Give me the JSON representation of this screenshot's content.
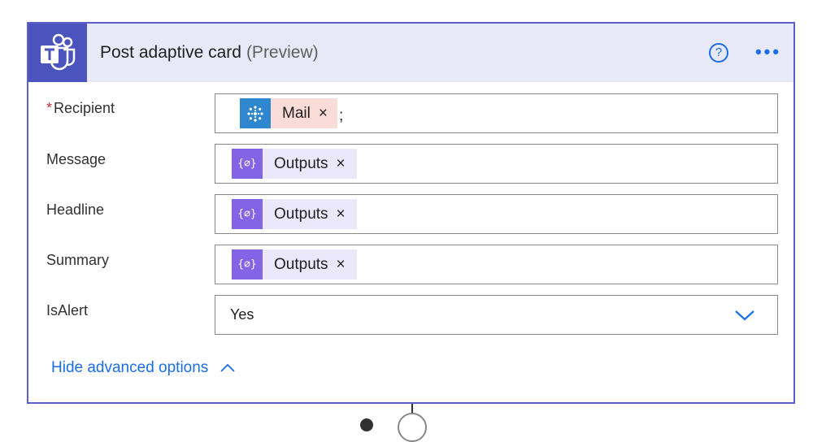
{
  "header": {
    "title": "Post adaptive card",
    "title_suffix": "(Preview)",
    "help_glyph": "?",
    "more_glyph": "•••",
    "icons": {
      "app": "teams-icon",
      "help": "help-circle-icon",
      "more": "more-icon"
    }
  },
  "fields": {
    "recipient": {
      "required_mark": "*",
      "label": "Recipient",
      "token": {
        "label": "Mail",
        "remove": "×",
        "icon": "dynamic-content-icon"
      },
      "trailing": ";"
    },
    "message": {
      "label": "Message",
      "token": {
        "label": "Outputs",
        "remove": "×",
        "icon_glyph": "{⌀}",
        "icon": "expression-icon"
      }
    },
    "headline": {
      "label": "Headline",
      "token": {
        "label": "Outputs",
        "remove": "×",
        "icon_glyph": "{⌀}",
        "icon": "expression-icon"
      }
    },
    "summary": {
      "label": "Summary",
      "token": {
        "label": "Outputs",
        "remove": "×",
        "icon_glyph": "{⌀}",
        "icon": "expression-icon"
      }
    },
    "isalert": {
      "label": "IsAlert",
      "value": "Yes",
      "icon": "chevron-down-icon"
    }
  },
  "advanced": {
    "label": "Hide advanced options",
    "icon": "chevron-up-icon"
  },
  "colors": {
    "accent": "#1a6ee6",
    "header_bg": "#e8e9f8",
    "card_border": "#5b5fc7",
    "teams_purple": "#4b53bc",
    "mail_token_bg": "#fadcd8",
    "expr_token_bg": "#ece8fb",
    "expr_icon_bg": "#8464e6",
    "mail_icon_bg": "#2f88cf"
  }
}
